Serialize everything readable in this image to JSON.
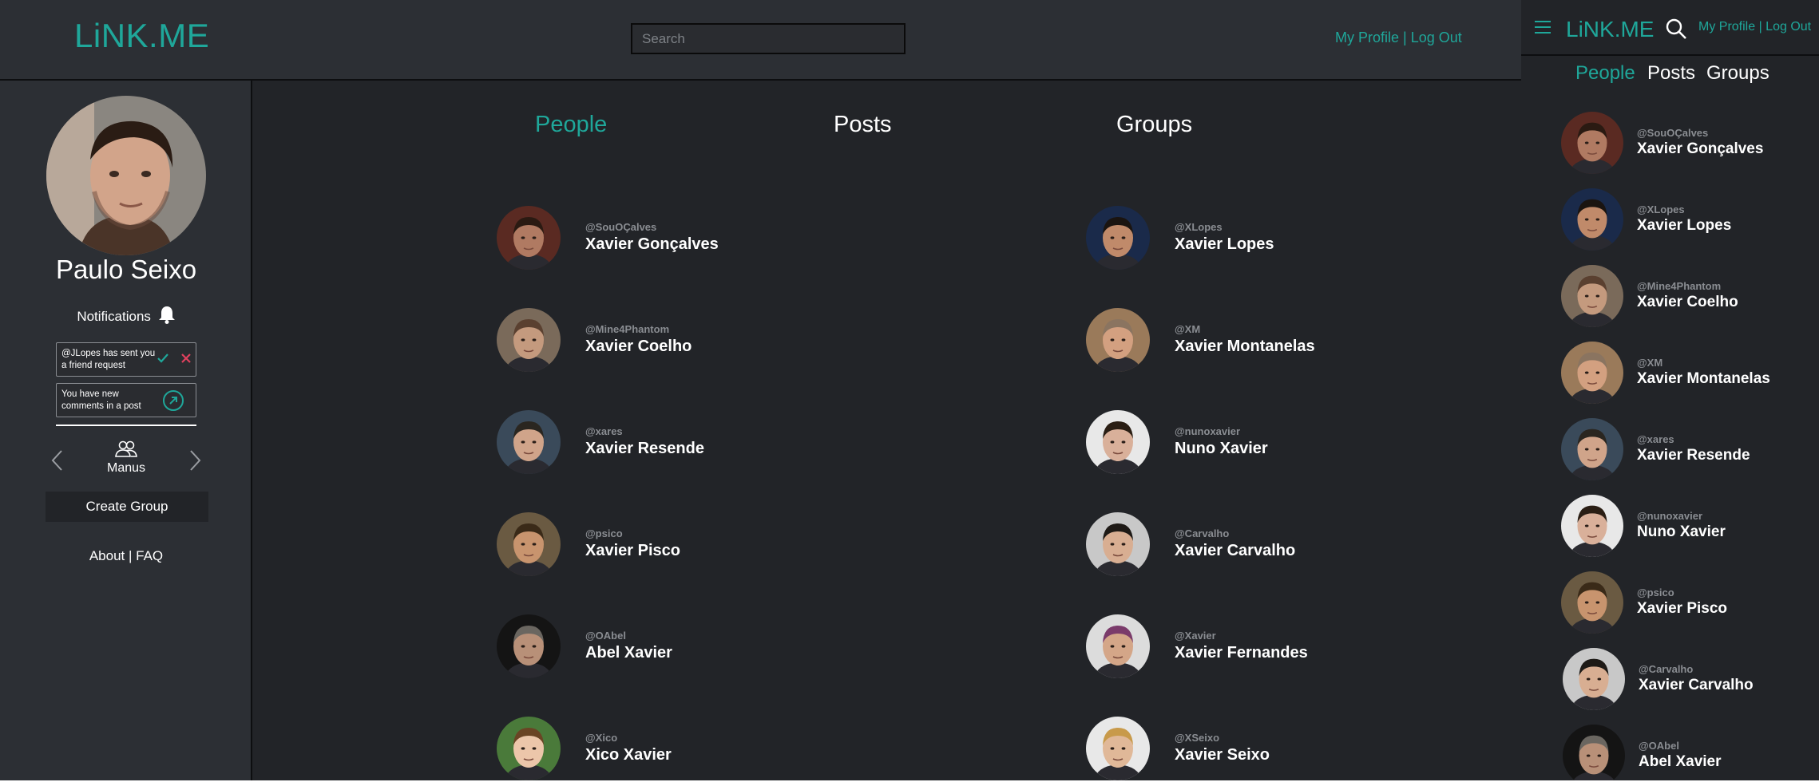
{
  "app": {
    "logo": "LiNK.ME",
    "search_placeholder": "Search",
    "my_profile": "My Profile",
    "separator": " | ",
    "log_out": "Log Out"
  },
  "sidebar": {
    "profile_name": "Paulo Seixo",
    "notifications_label": "Notifications",
    "notifications": [
      {
        "text": "@JLopes has sent you a friend request",
        "type": "friend-request"
      },
      {
        "text": "You have new comments in a post",
        "type": "open-link"
      }
    ],
    "group_name": "Manus",
    "create_group": "Create Group",
    "about": "About",
    "faq": "FAQ"
  },
  "tabs": [
    {
      "label": "People",
      "active": true
    },
    {
      "label": "Posts",
      "active": false
    },
    {
      "label": "Groups",
      "active": false
    }
  ],
  "people": [
    {
      "handle": "@SouOÇalves",
      "name": "Xavier Gonçalves",
      "skin": "#b07a62",
      "hair": "#2a1a12",
      "bg": "#5a2a22"
    },
    {
      "handle": "@XLopes",
      "name": "Xavier Lopes",
      "skin": "#c08a6a",
      "hair": "#1a1410",
      "bg": "#1a2a4a"
    },
    {
      "handle": "@Mine4Phantom",
      "name": "Xavier Coelho",
      "skin": "#c49a7e",
      "hair": "#5a4030",
      "bg": "#7a6a5a"
    },
    {
      "handle": "@XM",
      "name": "Xavier Montanelas",
      "skin": "#d3a080",
      "hair": "#8a7460",
      "bg": "#9a7a5a"
    },
    {
      "handle": "@xares",
      "name": "Xavier Resende",
      "skin": "#d0a48a",
      "hair": "#2a2620",
      "bg": "#3a4a5a"
    },
    {
      "handle": "@nunoxavier",
      "name": "Nuno Xavier",
      "skin": "#d9b09a",
      "hair": "#2a1e14",
      "bg": "#e8e8e8"
    },
    {
      "handle": "@psico",
      "name": "Xavier Pisco",
      "skin": "#c8946e",
      "hair": "#3a2a18",
      "bg": "#6a5a42"
    },
    {
      "handle": "@Carvalho",
      "name": "Xavier Carvalho",
      "skin": "#d8ae92",
      "hair": "#1e1a16",
      "bg": "#c8c8c8"
    },
    {
      "handle": "@OAbel",
      "name": "Abel Xavier",
      "skin": "#b89078",
      "hair": "#6a6660",
      "bg": "#141414"
    },
    {
      "handle": "@Xavier",
      "name": "Xavier Fernandes",
      "skin": "#d4a688",
      "hair": "#7a3a6a",
      "bg": "#dcdcdc"
    },
    {
      "handle": "@Xico",
      "name": "Xico Xavier",
      "skin": "#ecc6aa",
      "hair": "#6a4424",
      "bg": "#4a7a3a"
    },
    {
      "handle": "@XSeixo",
      "name": "Xavier Seixo",
      "skin": "#e0b898",
      "hair": "#c89a4a",
      "bg": "#e8e8e8"
    }
  ],
  "mobile_people": [
    {
      "handle": "@SouOÇalves",
      "name": "Xavier Gonçalves",
      "skin": "#b07a62",
      "hair": "#2a1a12",
      "bg": "#5a2a22"
    },
    {
      "handle": "@XLopes",
      "name": "Xavier Lopes",
      "skin": "#c08a6a",
      "hair": "#1a1410",
      "bg": "#1a2a4a"
    },
    {
      "handle": "@Mine4Phantom",
      "name": "Xavier Coelho",
      "skin": "#c49a7e",
      "hair": "#5a4030",
      "bg": "#7a6a5a"
    },
    {
      "handle": "@XM",
      "name": "Xavier Montanelas",
      "skin": "#d3a080",
      "hair": "#8a7460",
      "bg": "#9a7a5a"
    },
    {
      "handle": "@xares",
      "name": "Xavier Resende",
      "skin": "#d0a48a",
      "hair": "#2a2620",
      "bg": "#3a4a5a"
    },
    {
      "handle": "@nunoxavier",
      "name": "Nuno Xavier",
      "skin": "#d9b09a",
      "hair": "#2a1e14",
      "bg": "#e8e8e8"
    },
    {
      "handle": "@psico",
      "name": "Xavier Pisco",
      "skin": "#c8946e",
      "hair": "#3a2a18",
      "bg": "#6a5a42"
    },
    {
      "handle": "@Carvalho",
      "name": "Xavier Carvalho",
      "skin": "#d8ae92",
      "hair": "#1e1a16",
      "bg": "#c8c8c8"
    },
    {
      "handle": "@OAbel",
      "name": "Abel Xavier",
      "skin": "#b89078",
      "hair": "#6a6660",
      "bg": "#141414"
    }
  ],
  "colors": {
    "accent": "#1fa79a",
    "background": "#222428",
    "panel": "#2c2f34",
    "muted": "#8a8d92",
    "reject": "#e0415e"
  }
}
